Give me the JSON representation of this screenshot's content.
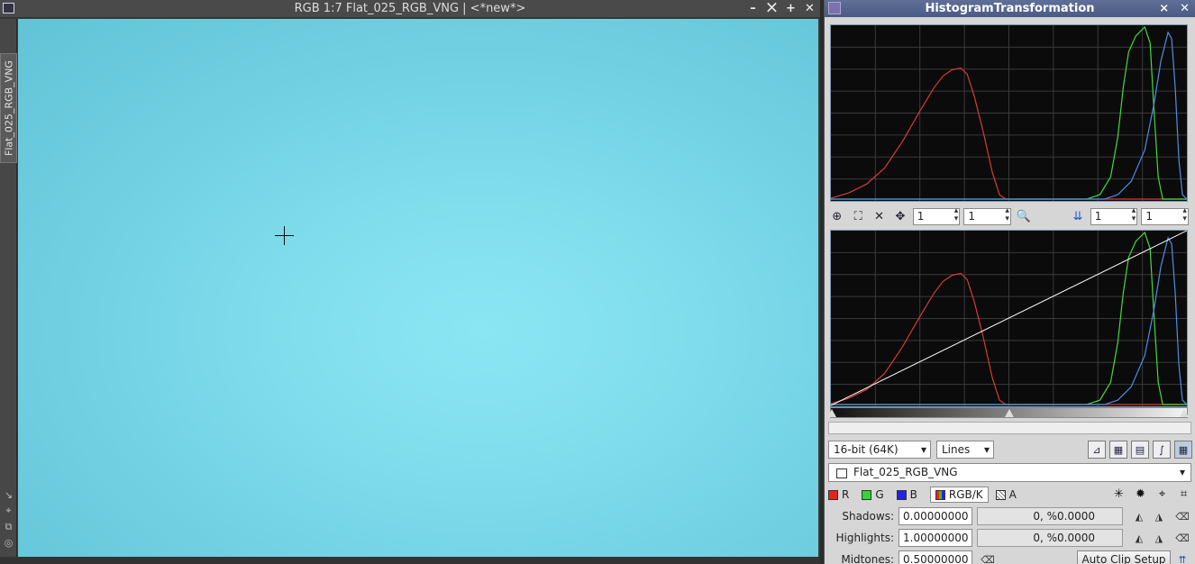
{
  "image_window": {
    "title": "RGB 1:7 Flat_025_RGB_VNG | <*new*>",
    "side_tab": "Flat_025_RGB_VNG",
    "buttons": [
      "–",
      "⨉",
      "+",
      "✕"
    ]
  },
  "histogram": {
    "title": "HistogramTransformation",
    "toolbar": {
      "zoom_x": "1",
      "zoom_y": "1",
      "zoom_x2": "1",
      "zoom_y2": "1"
    },
    "resolution": "16-bit (64K)",
    "graph_style": "Lines",
    "view": "Flat_025_RGB_VNG",
    "channels": {
      "r": "R",
      "g": "G",
      "b": "B",
      "rgbk": "RGB/K",
      "a": "A"
    },
    "colors": {
      "r": "#d93a3a",
      "g": "#3fdc3f",
      "b": "#4d8ee8",
      "curve": "#ffffff"
    },
    "shadows": {
      "label": "Shadows:",
      "value": "0.00000000",
      "clip": "0, %0.0000"
    },
    "highlights": {
      "label": "Highlights:",
      "value": "1.00000000",
      "clip": "0, %0.0000"
    },
    "midtones": {
      "label": "Midtones:",
      "value": "0.50000000",
      "auto_clip": "Auto Clip Setup"
    }
  }
}
